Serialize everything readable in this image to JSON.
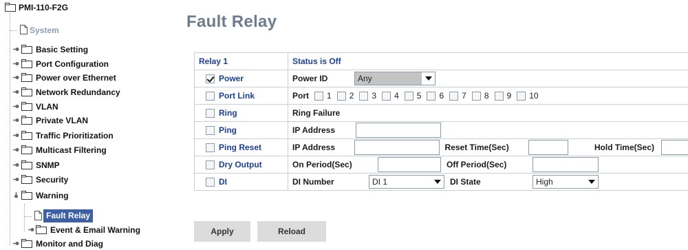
{
  "tree": {
    "root": "PMI-110-F2G",
    "items": [
      {
        "label": "System"
      },
      {
        "label": "Basic Setting"
      },
      {
        "label": "Port Configuration"
      },
      {
        "label": "Power over Ethernet"
      },
      {
        "label": "Network Redundancy"
      },
      {
        "label": "VLAN"
      },
      {
        "label": "Private VLAN"
      },
      {
        "label": "Traffic Prioritization"
      },
      {
        "label": "Multicast Filtering"
      },
      {
        "label": "SNMP"
      },
      {
        "label": "Security"
      },
      {
        "label": "Warning"
      },
      {
        "label": "Fault Relay"
      },
      {
        "label": "Event & Email Warning"
      },
      {
        "label": "Monitor and Diag"
      }
    ]
  },
  "page_title": "Fault Relay",
  "table": {
    "relay_label": "Relay 1",
    "status": "Status is Off",
    "rows": {
      "power": {
        "name": "Power",
        "checked": true,
        "field_label": "Power ID",
        "select_value": "Any"
      },
      "port_link": {
        "name": "Port Link",
        "field_label": "Port",
        "ports": [
          "1",
          "2",
          "3",
          "4",
          "5",
          "6",
          "7",
          "8",
          "9",
          "10"
        ]
      },
      "ring": {
        "name": "Ring",
        "field_label": "Ring Failure"
      },
      "ping": {
        "name": "Ping",
        "field_label": "IP Address"
      },
      "ping_reset": {
        "name": "Ping Reset",
        "ip_label": "IP Address",
        "reset_label": "Reset Time(Sec)",
        "hold_label": "Hold Time(Sec)"
      },
      "dry_output": {
        "name": "Dry Output",
        "on_label": "On Period(Sec)",
        "off_label": "Off Period(Sec)"
      },
      "di": {
        "name": "DI",
        "number_label": "DI Number",
        "number_value": "DI 1",
        "state_label": "DI State",
        "state_value": "High"
      }
    }
  },
  "buttons": {
    "apply": "Apply",
    "reload": "Reload"
  },
  "colors": {
    "title": "#6b7d8f",
    "link_text": "#1c3f94",
    "grid": "#c7d0da",
    "selected_bg": "#3c5fa6"
  }
}
